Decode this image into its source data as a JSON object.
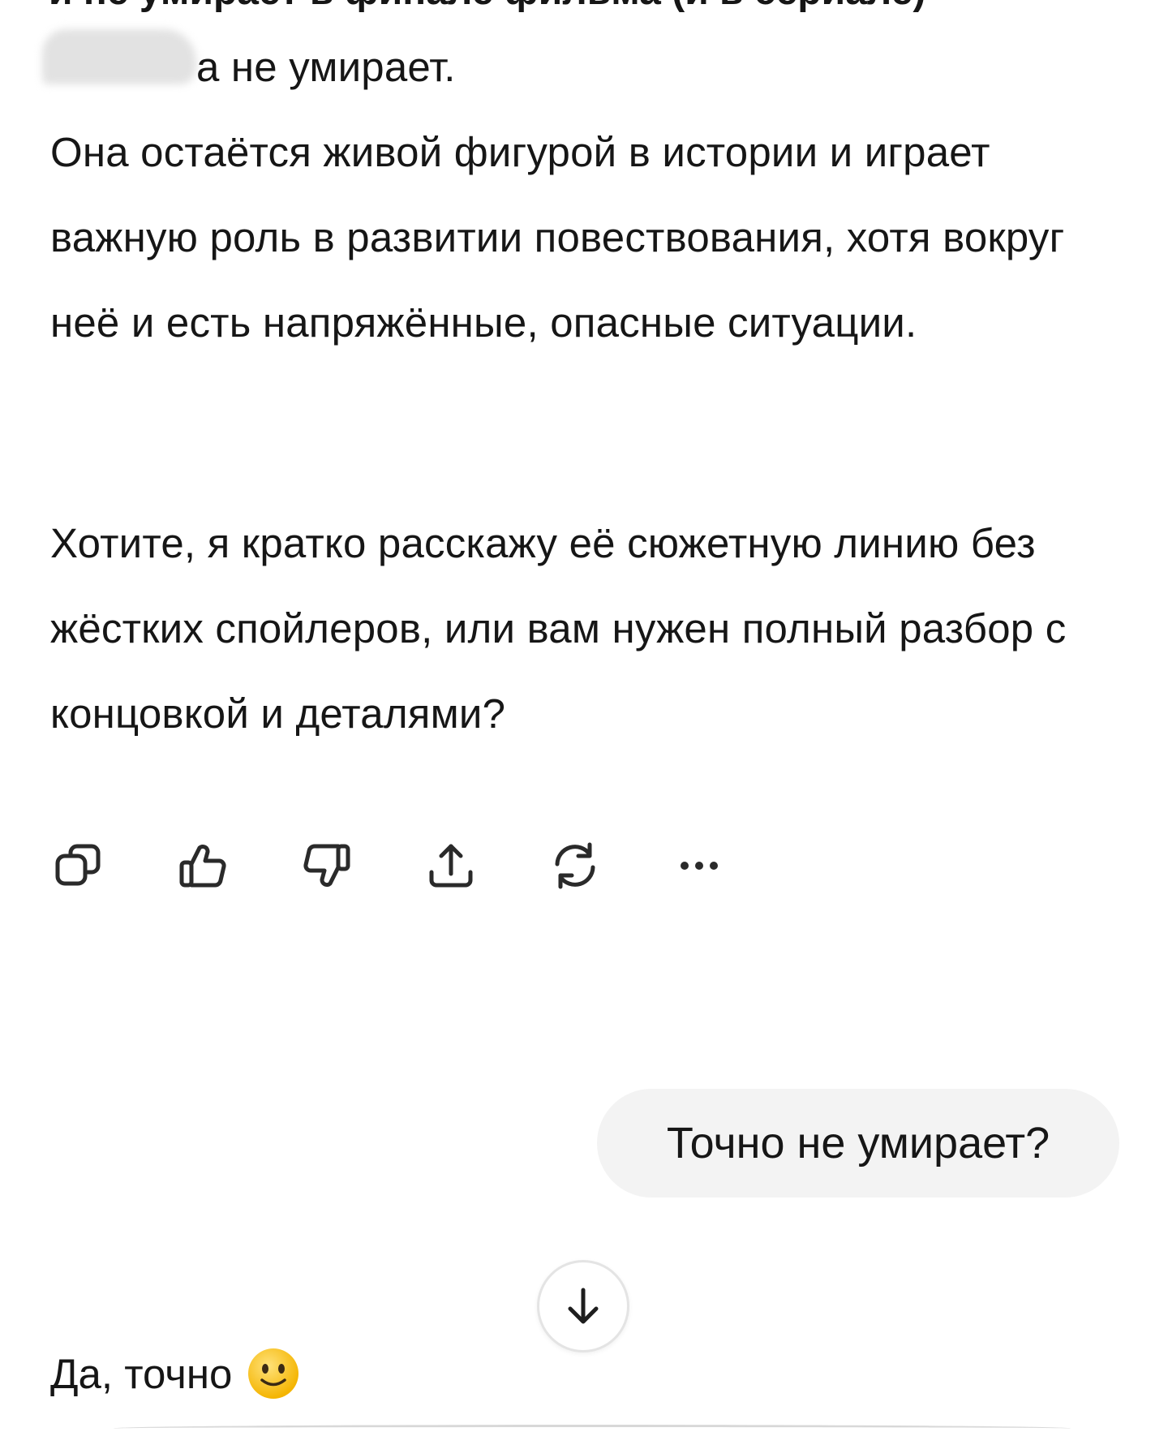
{
  "message": {
    "cut_top_line": "и не умирает в финале фильма (и в сериале)",
    "first_line_visible": "а не умирает.",
    "paragraph_1": "Она остаётся живой фигурой в истории и играет важную роль в развитии повествования, хотя вокруг неё и есть напряжённые, опасные ситуации.",
    "paragraph_2": "Хотите, я кратко расскажу её сюжетную линию без жёстких спойлеров, или вам нужен полный разбор с концовкой и деталями?"
  },
  "actions": [
    {
      "name": "copy-icon"
    },
    {
      "name": "thumbs-up-icon"
    },
    {
      "name": "thumbs-down-icon"
    },
    {
      "name": "share-icon"
    },
    {
      "name": "regenerate-icon"
    },
    {
      "name": "more-icon"
    }
  ],
  "user_message": {
    "text": "Точно не умирает?"
  },
  "scroll_button": {
    "icon": "arrow-down-icon"
  },
  "assistant_reply": {
    "text": "Да, точно",
    "emoji": "slightly-smiling-face-icon"
  },
  "colors": {
    "text": "#161616",
    "bubble_bg": "#f3f3f3",
    "emoji_face": "#ffc83d"
  }
}
